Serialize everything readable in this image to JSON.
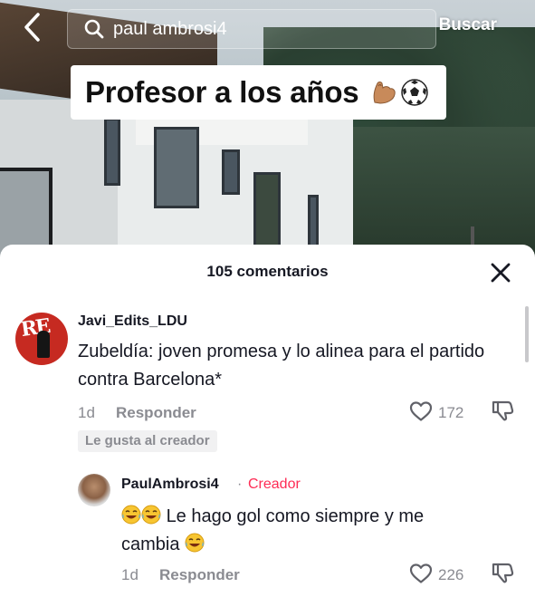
{
  "search": {
    "query": "paul ambrosi4",
    "submit_label": "Buscar"
  },
  "caption": {
    "text": "Profesor a los años",
    "emojis": [
      "flexed-biceps-emoji",
      "soccer-ball-emoji"
    ]
  },
  "comments_sheet": {
    "title": "105 comentarios",
    "comments": [
      {
        "username": "Javi_Edits_LDU",
        "text": "Zubeldía: joven promesa y lo alinea para el partido contra Barcelona*",
        "time": "1d",
        "reply_label": "Responder",
        "likes": "172",
        "badge": "Le gusta al creador"
      },
      {
        "username": "PaulAmbrosi4",
        "separator": "·",
        "role": "Creador",
        "text_part1": "Le hago gol como siempre y me",
        "text_part2": "cambia",
        "time": "1d",
        "reply_label": "Responder",
        "likes": "226"
      }
    ]
  },
  "colors": {
    "creator_accent": "#fe2c55",
    "muted_text": "#8a8b91",
    "primary_text": "#161823"
  }
}
